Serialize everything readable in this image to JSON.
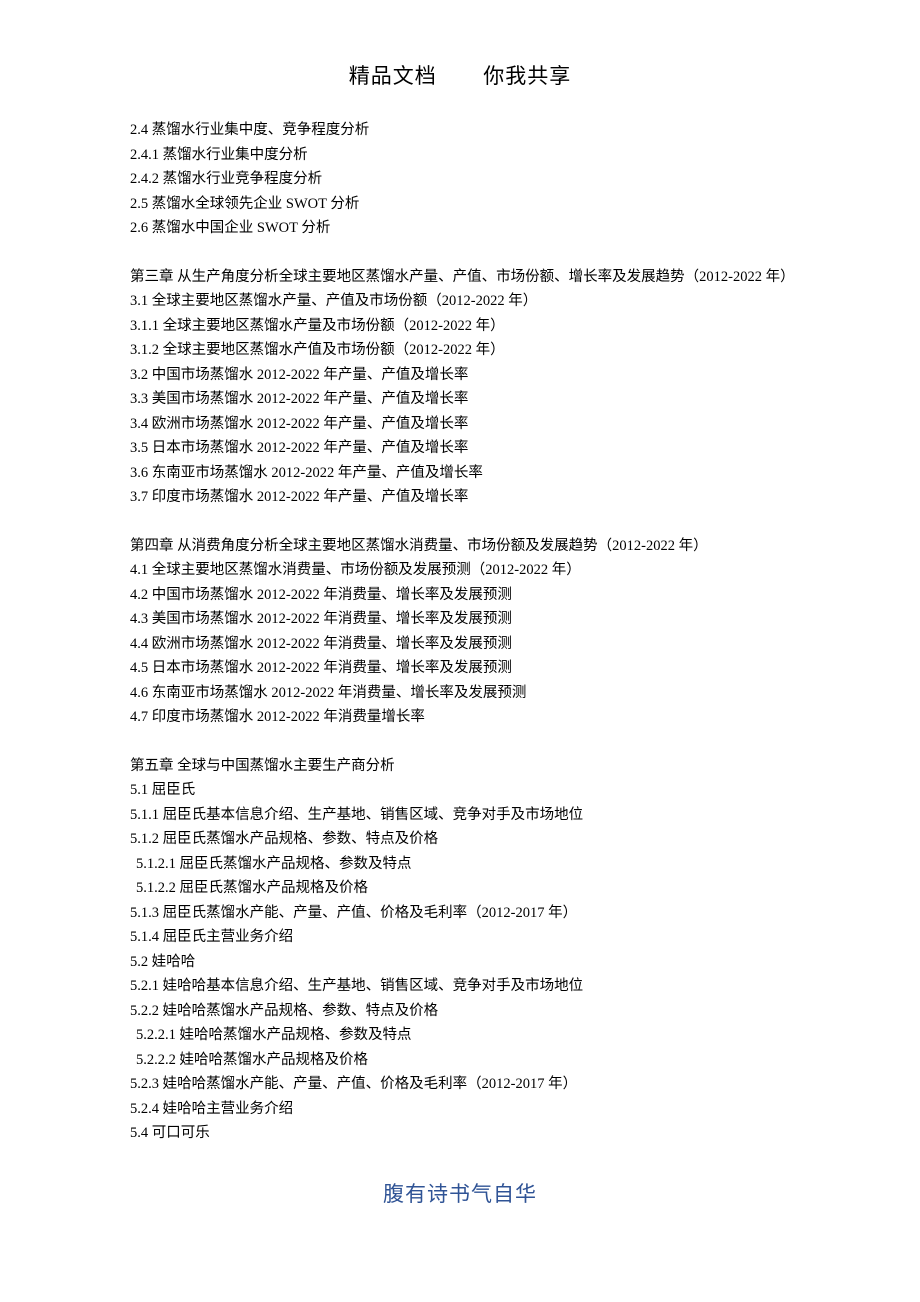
{
  "header": {
    "part1": "精品文档",
    "part2": "你我共享"
  },
  "lines": [
    {
      "t": "2.4 蒸馏水行业集中度、竞争程度分析"
    },
    {
      "t": "2.4.1 蒸馏水行业集中度分析"
    },
    {
      "t": "2.4.2 蒸馏水行业竞争程度分析"
    },
    {
      "t": "2.5 蒸馏水全球领先企业 SWOT 分析"
    },
    {
      "t": "2.6 蒸馏水中国企业 SWOT 分析"
    },
    {
      "blank": true
    },
    {
      "t": "第三章 从生产角度分析全球主要地区蒸馏水产量、产值、市场份额、增长率及发展趋势（2012-2022 年）"
    },
    {
      "t": "3.1 全球主要地区蒸馏水产量、产值及市场份额（2012-2022 年）"
    },
    {
      "t": "3.1.1 全球主要地区蒸馏水产量及市场份额（2012-2022 年）"
    },
    {
      "t": "3.1.2 全球主要地区蒸馏水产值及市场份额（2012-2022 年）"
    },
    {
      "t": "3.2 中国市场蒸馏水 2012-2022 年产量、产值及增长率"
    },
    {
      "t": "3.3 美国市场蒸馏水 2012-2022 年产量、产值及增长率"
    },
    {
      "t": "3.4 欧洲市场蒸馏水 2012-2022 年产量、产值及增长率"
    },
    {
      "t": "3.5 日本市场蒸馏水 2012-2022 年产量、产值及增长率"
    },
    {
      "t": "3.6 东南亚市场蒸馏水 2012-2022 年产量、产值及增长率"
    },
    {
      "t": "3.7 印度市场蒸馏水 2012-2022 年产量、产值及增长率"
    },
    {
      "blank": true
    },
    {
      "t": "第四章 从消费角度分析全球主要地区蒸馏水消费量、市场份额及发展趋势（2012-2022 年）"
    },
    {
      "t": "4.1 全球主要地区蒸馏水消费量、市场份额及发展预测（2012-2022 年）"
    },
    {
      "t": "4.2 中国市场蒸馏水 2012-2022 年消费量、增长率及发展预测"
    },
    {
      "t": "4.3 美国市场蒸馏水 2012-2022 年消费量、增长率及发展预测"
    },
    {
      "t": "4.4 欧洲市场蒸馏水 2012-2022 年消费量、增长率及发展预测"
    },
    {
      "t": "4.5 日本市场蒸馏水 2012-2022 年消费量、增长率及发展预测"
    },
    {
      "t": "4.6 东南亚市场蒸馏水 2012-2022 年消费量、增长率及发展预测"
    },
    {
      "t": "4.7 印度市场蒸馏水 2012-2022 年消费量增长率"
    },
    {
      "blank": true
    },
    {
      "t": "第五章 全球与中国蒸馏水主要生产商分析"
    },
    {
      "t": "5.1 屈臣氏"
    },
    {
      "t": "5.1.1 屈臣氏基本信息介绍、生产基地、销售区域、竞争对手及市场地位"
    },
    {
      "t": "5.1.2 屈臣氏蒸馏水产品规格、参数、特点及价格"
    },
    {
      "t": "5.1.2.1 屈臣氏蒸馏水产品规格、参数及特点",
      "indent": 1
    },
    {
      "t": "5.1.2.2 屈臣氏蒸馏水产品规格及价格",
      "indent": 1
    },
    {
      "t": "5.1.3 屈臣氏蒸馏水产能、产量、产值、价格及毛利率（2012-2017 年）"
    },
    {
      "t": "5.1.4 屈臣氏主营业务介绍"
    },
    {
      "t": "5.2 娃哈哈"
    },
    {
      "t": "5.2.1 娃哈哈基本信息介绍、生产基地、销售区域、竞争对手及市场地位"
    },
    {
      "t": "5.2.2 娃哈哈蒸馏水产品规格、参数、特点及价格"
    },
    {
      "t": "5.2.2.1 娃哈哈蒸馏水产品规格、参数及特点",
      "indent": 1
    },
    {
      "t": "5.2.2.2 娃哈哈蒸馏水产品规格及价格",
      "indent": 1
    },
    {
      "t": "5.2.3 娃哈哈蒸馏水产能、产量、产值、价格及毛利率（2012-2017 年）"
    },
    {
      "t": "5.2.4 娃哈哈主营业务介绍"
    },
    {
      "t": "5.4 可口可乐"
    }
  ],
  "footer": "腹有诗书气自华"
}
